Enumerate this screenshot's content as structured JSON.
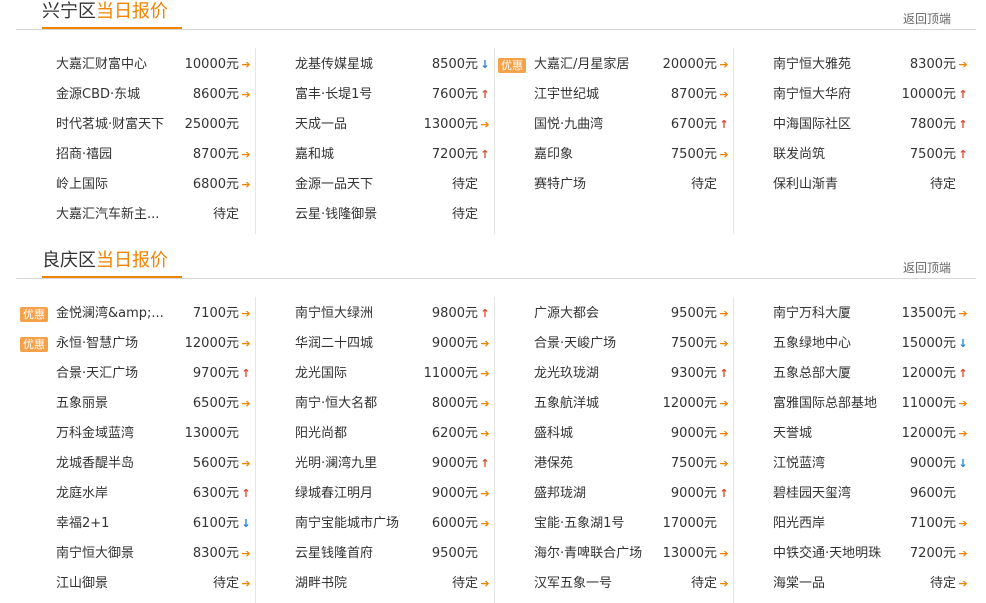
{
  "sections": [
    {
      "district": "兴宁区",
      "title_suffix": "当日报价",
      "back_label": "返回顶端",
      "columns": [
        [
          {
            "name": "大嘉汇财富中心",
            "price": "10000元",
            "arrow": "flat"
          },
          {
            "name": "金源CBD·东城",
            "price": "8600元",
            "arrow": "flat"
          },
          {
            "name": "时代茗城·财富天下",
            "price": "25000元",
            "arrow": "none"
          },
          {
            "name": "招商·禧园",
            "price": "8700元",
            "arrow": "flat"
          },
          {
            "name": "岭上国际",
            "price": "6800元",
            "arrow": "flat"
          },
          {
            "name": "大嘉汇汽车新主...",
            "price": "待定",
            "arrow": "none"
          }
        ],
        [
          {
            "name": "龙基传媒星城",
            "price": "8500元",
            "arrow": "down"
          },
          {
            "name": "富丰·长堤1号",
            "price": "7600元",
            "arrow": "up"
          },
          {
            "name": "天成一品",
            "price": "13000元",
            "arrow": "flat"
          },
          {
            "name": "嘉和城",
            "price": "7200元",
            "arrow": "up"
          },
          {
            "name": "金源一品天下",
            "price": "待定",
            "arrow": "none"
          },
          {
            "name": "云星·钱隆御景",
            "price": "待定",
            "arrow": "none"
          }
        ],
        [
          {
            "name": "大嘉汇/月星家居",
            "price": "20000元",
            "arrow": "flat",
            "badge": "优惠"
          },
          {
            "name": "江宇世纪城",
            "price": "8700元",
            "arrow": "flat"
          },
          {
            "name": "国悦·九曲湾",
            "price": "6700元",
            "arrow": "up"
          },
          {
            "name": "嘉印象",
            "price": "7500元",
            "arrow": "flat"
          },
          {
            "name": "赛特广场",
            "price": "待定",
            "arrow": "none"
          }
        ],
        [
          {
            "name": "南宁恒大雅苑",
            "price": "8300元",
            "arrow": "flat"
          },
          {
            "name": "南宁恒大华府",
            "price": "10000元",
            "arrow": "up"
          },
          {
            "name": "中海国际社区",
            "price": "7800元",
            "arrow": "up"
          },
          {
            "name": "联发尚筑",
            "price": "7500元",
            "arrow": "up"
          },
          {
            "name": "保利山渐青",
            "price": "待定",
            "arrow": "none"
          }
        ]
      ]
    },
    {
      "district": "良庆区",
      "title_suffix": "当日报价",
      "back_label": "返回顶端",
      "columns": [
        [
          {
            "name": "金悦澜湾&amp;...",
            "price": "7100元",
            "arrow": "flat",
            "badge": "优惠"
          },
          {
            "name": "永恒·智慧广场",
            "price": "12000元",
            "arrow": "flat",
            "badge": "优惠"
          },
          {
            "name": "合景·天汇广场",
            "price": "9700元",
            "arrow": "up"
          },
          {
            "name": "五象丽景",
            "price": "6500元",
            "arrow": "flat"
          },
          {
            "name": "万科金域蓝湾",
            "price": "13000元",
            "arrow": "none"
          },
          {
            "name": "龙城香醍半岛",
            "price": "5600元",
            "arrow": "flat"
          },
          {
            "name": "龙庭水岸",
            "price": "6300元",
            "arrow": "up"
          },
          {
            "name": "幸福2+1",
            "price": "6100元",
            "arrow": "down"
          },
          {
            "name": "南宁恒大御景",
            "price": "8300元",
            "arrow": "flat"
          },
          {
            "name": "江山御景",
            "price": "待定",
            "arrow": "flat"
          }
        ],
        [
          {
            "name": "南宁恒大绿洲",
            "price": "9800元",
            "arrow": "up"
          },
          {
            "name": "华润二十四城",
            "price": "9000元",
            "arrow": "flat"
          },
          {
            "name": "龙光国际",
            "price": "11000元",
            "arrow": "flat"
          },
          {
            "name": "南宁·恒大名都",
            "price": "8000元",
            "arrow": "flat"
          },
          {
            "name": "阳光尚都",
            "price": "6200元",
            "arrow": "flat"
          },
          {
            "name": "光明·澜湾九里",
            "price": "9000元",
            "arrow": "up"
          },
          {
            "name": "绿城春江明月",
            "price": "9000元",
            "arrow": "flat"
          },
          {
            "name": "南宁宝能城市广场",
            "price": "6000元",
            "arrow": "flat"
          },
          {
            "name": "云星钱隆首府",
            "price": "9500元",
            "arrow": "none"
          },
          {
            "name": "湖畔书院",
            "price": "待定",
            "arrow": "flat"
          }
        ],
        [
          {
            "name": "广源大都会",
            "price": "9500元",
            "arrow": "flat"
          },
          {
            "name": "合景·天峻广场",
            "price": "7500元",
            "arrow": "flat"
          },
          {
            "name": "龙光玖珑湖",
            "price": "9300元",
            "arrow": "up"
          },
          {
            "name": "五象航洋城",
            "price": "12000元",
            "arrow": "flat"
          },
          {
            "name": "盛科城",
            "price": "9000元",
            "arrow": "flat"
          },
          {
            "name": "港保苑",
            "price": "7500元",
            "arrow": "flat"
          },
          {
            "name": "盛邦珑湖",
            "price": "9000元",
            "arrow": "up"
          },
          {
            "name": "宝能·五象湖1号",
            "price": "17000元",
            "arrow": "none"
          },
          {
            "name": "海尔·青啤联合广场",
            "price": "13000元",
            "arrow": "flat"
          },
          {
            "name": "汉军五象一号",
            "price": "待定",
            "arrow": "flat"
          }
        ],
        [
          {
            "name": "南宁万科大厦",
            "price": "13500元",
            "arrow": "flat"
          },
          {
            "name": "五象绿地中心",
            "price": "15000元",
            "arrow": "down"
          },
          {
            "name": "五象总部大厦",
            "price": "12000元",
            "arrow": "up"
          },
          {
            "name": "富雅国际总部基地",
            "price": "11000元",
            "arrow": "flat"
          },
          {
            "name": "天誉城",
            "price": "12000元",
            "arrow": "flat"
          },
          {
            "name": "江悦蓝湾",
            "price": "9000元",
            "arrow": "down"
          },
          {
            "name": "碧桂园天玺湾",
            "price": "9600元",
            "arrow": "none"
          },
          {
            "name": "阳光西岸",
            "price": "7100元",
            "arrow": "flat"
          },
          {
            "name": "中铁交通·天地明珠",
            "price": "7200元",
            "arrow": "flat"
          },
          {
            "name": "海棠一品",
            "price": "待定",
            "arrow": "flat"
          }
        ]
      ]
    }
  ],
  "arrow_glyphs": {
    "flat": "➔",
    "up": "↑",
    "down": "↓",
    "none": ""
  },
  "colors": {
    "accent": "#f08300",
    "up": "#e0442a",
    "down": "#1f7fd6",
    "badge": "#f5a14a"
  }
}
